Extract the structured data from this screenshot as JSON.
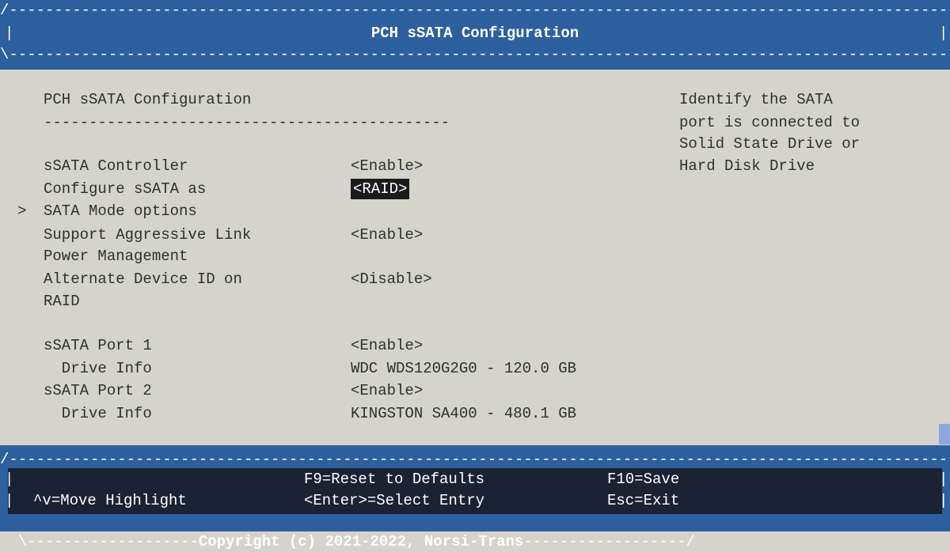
{
  "header": {
    "title": "PCH sSATA Configuration",
    "border_top": "/----------------------------------------------------------------------------------------------------------------\\",
    "border_bottom": "\\----------------------------------------------------------------------------------------------------------------/",
    "side_bar": "|"
  },
  "main": {
    "section_title": "PCH sSATA Configuration",
    "section_rule": "---------------------------------------------",
    "cursor": ">",
    "items": [
      {
        "label": "sSATA Controller",
        "value": "<Enable>"
      },
      {
        "label": "Configure sSATA as",
        "value": "<RAID>"
      },
      {
        "label": "SATA Mode options",
        "value": ""
      },
      {
        "label": "Support Aggressive Link",
        "label2": "Power Management",
        "value": "<Enable>"
      },
      {
        "label": "Alternate Device ID on",
        "label2": "RAID",
        "value": "<Disable>"
      },
      {
        "label": "sSATA Port 1",
        "value": "<Enable>"
      },
      {
        "label": "  Drive Info",
        "value": "WDC WDS120G2G0 - 120.0 GB"
      },
      {
        "label": "sSATA Port 2",
        "value": "<Enable>"
      },
      {
        "label": "  Drive Info",
        "value": "KINGSTON SA400 - 480.1 GB"
      }
    ]
  },
  "help": {
    "lines": [
      "Identify the SATA",
      "port is connected to",
      "Solid State Drive or",
      "Hard Disk Drive"
    ]
  },
  "footer": {
    "border_top": "/----------------------------------------------------------------------------------------------------------------\\",
    "reset": "F9=Reset to Defaults",
    "save": "F10=Save",
    "move": "^v=Move Highlight",
    "select": "<Enter>=Select Entry",
    "exit": "Esc=Exit",
    "copyright": "Copyright (c) 2021-2022, Norsi-Trans",
    "copyright_dashes_left": "\\-------------------",
    "copyright_dashes_right": "------------------/",
    "side_bar": "|"
  },
  "colors": {
    "header_bg": "#2e5f9e",
    "body_bg": "#d4d4cc",
    "dark_band": "#1b2234",
    "selected_bg": "#1b1b1b",
    "scroll_thumb": "#8aa7e0"
  }
}
